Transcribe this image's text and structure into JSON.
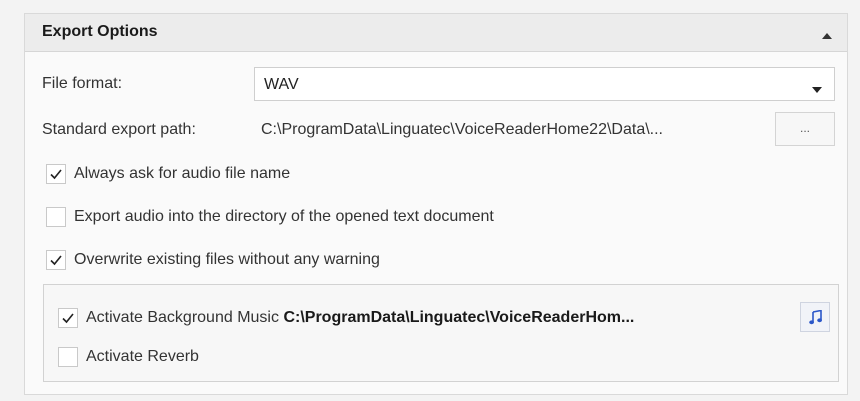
{
  "panel": {
    "title": "Export Options"
  },
  "file_format": {
    "label": "File format:",
    "value": "WAV"
  },
  "export_path": {
    "label": "Standard export path:",
    "value": "C:\\ProgramData\\Linguatec\\VoiceReaderHome22\\Data\\...",
    "browse_label": "..."
  },
  "options": [
    {
      "label": "Always ask for audio file name",
      "checked": true
    },
    {
      "label": "Export audio into the directory of the opened text document",
      "checked": false
    },
    {
      "label": "Overwrite existing files without any warning",
      "checked": true
    }
  ],
  "background_music": {
    "label": "Activate Background Music",
    "path": "C:\\ProgramData\\Linguatec\\VoiceReaderHom...",
    "checked": true
  },
  "reverb": {
    "label": "Activate Reverb",
    "checked": false
  },
  "colors": {
    "accent": "#2b57c9",
    "check_mark": "#222222"
  },
  "icons": {
    "collapse": "chevron-up-icon",
    "dropdown": "chevron-down-icon",
    "music": "music-note-icon",
    "check": "checkmark-icon"
  }
}
